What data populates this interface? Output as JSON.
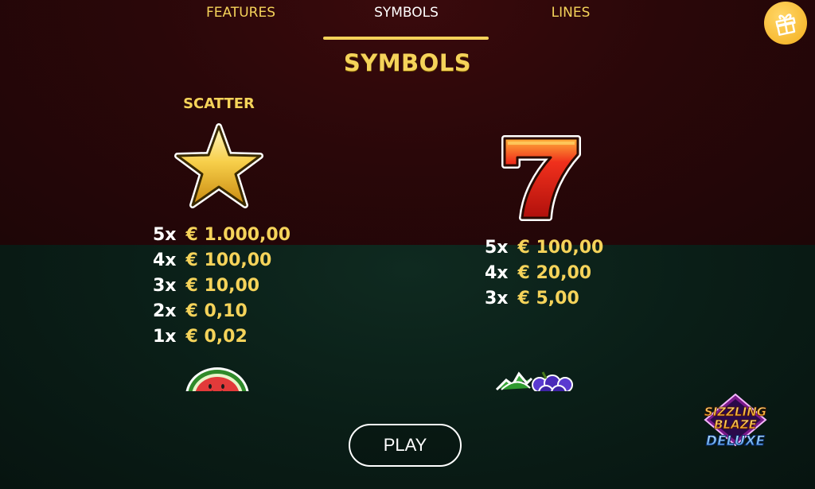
{
  "tabs": [
    {
      "label": "FEATURES"
    },
    {
      "label": "SYMBOLS"
    },
    {
      "label": "LINES"
    }
  ],
  "active_tab": "SYMBOLS",
  "page_title": "SYMBOLS",
  "scatter": {
    "label": "SCATTER",
    "icon": "star-icon",
    "payouts": [
      {
        "multiplier": "5x",
        "value": "€ 1.000,00"
      },
      {
        "multiplier": "4x",
        "value": "€ 100,00"
      },
      {
        "multiplier": "3x",
        "value": "€ 10,00"
      },
      {
        "multiplier": "2x",
        "value": "€ 0,10"
      },
      {
        "multiplier": "1x",
        "value": "€ 0,02"
      }
    ]
  },
  "seven": {
    "icon": "seven-icon",
    "payouts": [
      {
        "multiplier": "5x",
        "value": "€ 100,00"
      },
      {
        "multiplier": "4x",
        "value": "€ 20,00"
      },
      {
        "multiplier": "3x",
        "value": "€ 5,00"
      }
    ]
  },
  "next_symbols": [
    "watermelon-icon",
    "grapes-icon"
  ],
  "play_button": "PLAY",
  "logo": {
    "line1": "SIZZLING",
    "line2": "BLAZE",
    "line3": "DELUXE"
  },
  "colors": {
    "accent": "#f5d35a",
    "top_bg": "#2a0709",
    "bottom_bg": "#0a1e17"
  }
}
